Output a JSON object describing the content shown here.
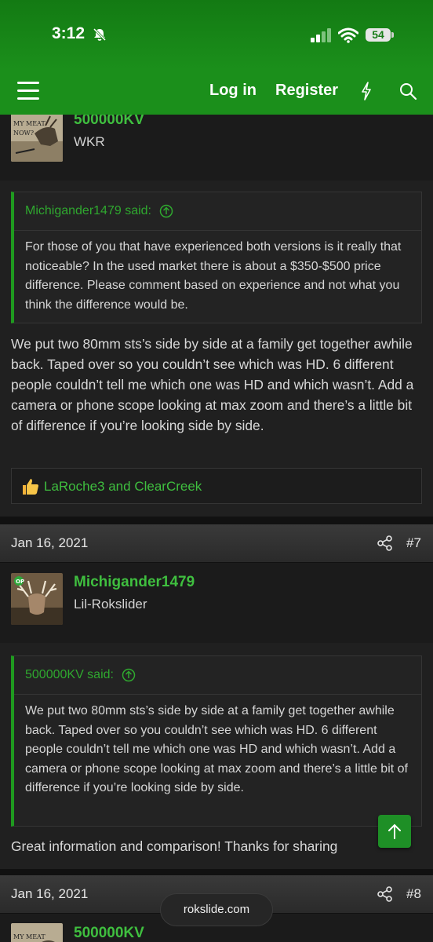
{
  "status": {
    "time": "3:12",
    "battery": "54"
  },
  "nav": {
    "login": "Log in",
    "register": "Register"
  },
  "posts": [
    {
      "username": "500000KV",
      "user_title": "WKR",
      "quote_author": "Michigander1479 said:",
      "quote_text": "For those of you that have experienced both versions is it really that noticeable? In the used market there is about a $350-$500 price difference. Please comment based on experience and not what you think the difference would be.",
      "text": "We put two 80mm sts’s side by side at a family get together awhile back. Taped over so you couldn’t see which was HD. 6 different people couldn’t tell me which one was HD and which wasn’t. Add a camera or phone scope looking at max zoom and there’s a little bit of difference if you’re looking side by side.",
      "reactions": "LaRoche3 and ClearCreek"
    },
    {
      "date": "Jan 16, 2021",
      "number": "#7",
      "username": "Michigander1479",
      "user_title": "Lil-Rokslider",
      "quote_author": "500000KV said:",
      "quote_text": "We put two 80mm sts’s side by side at a family get together awhile back. Taped over so you couldn’t see which was HD. 6 different people couldn’t tell me which one was HD and which wasn’t. Add a camera or phone scope looking at max zoom and there’s a little bit of difference if you’re looking side by side.",
      "text": "Great information and comparison! Thanks for sharing"
    },
    {
      "date": "Jan 16, 2021",
      "number": "#8",
      "username": "500000KV"
    }
  ],
  "browser": {
    "url": "rokslide.com"
  },
  "colors": {
    "brand_green": "#1b8f1b",
    "link_green": "#3fbf3f"
  }
}
